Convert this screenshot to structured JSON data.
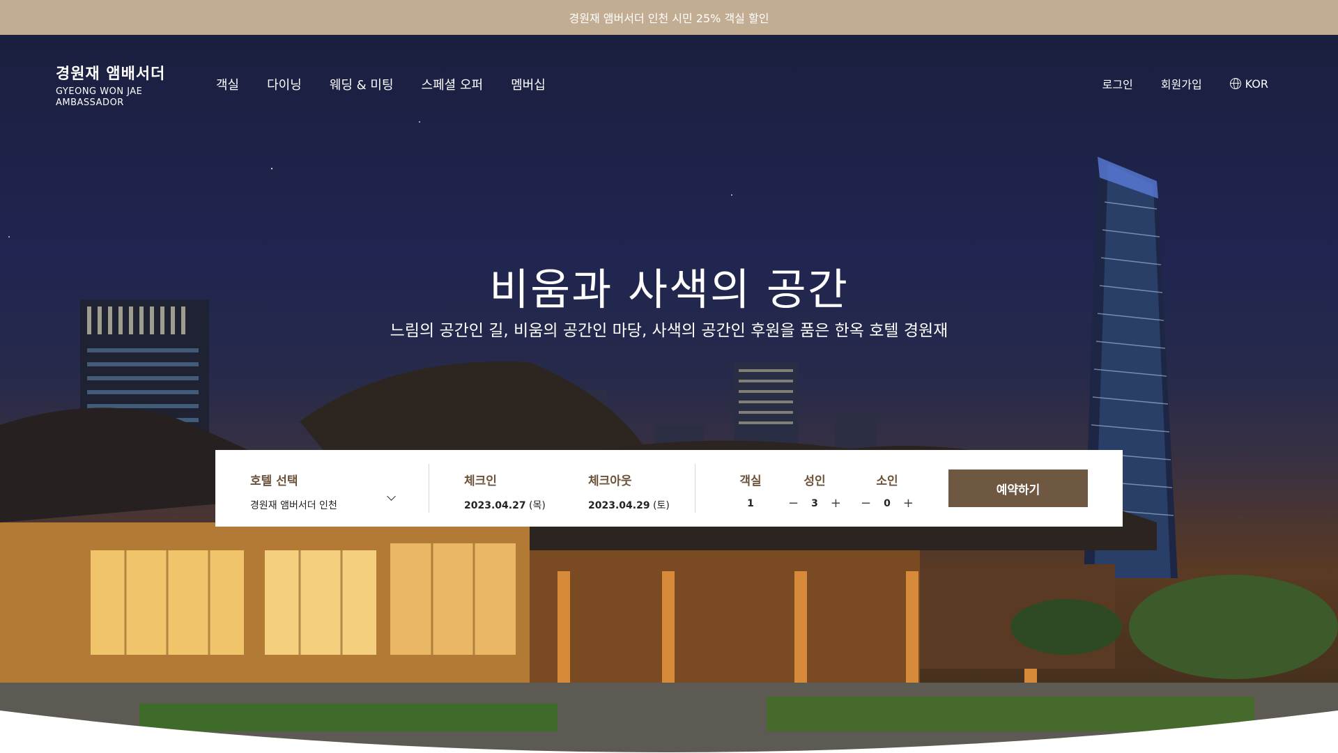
{
  "promo": {
    "text": "경원재 앰버서더 인천 시민 25% 객실 할인"
  },
  "header": {
    "logo_kr": "경원재 앰배서더",
    "logo_en_line1": "GYEONG WON JAE",
    "logo_en_line2": "AMBASSADOR",
    "nav": [
      "객실",
      "다이닝",
      "웨딩 & 미팅",
      "스페셜 오퍼",
      "멤버십"
    ],
    "login": "로그인",
    "signup": "회원가입",
    "lang": "KOR"
  },
  "hero": {
    "title": "비움과 사색의 공간",
    "subtitle": "느림의 공간인 길, 비움의 공간인 마당, 사색의 공간인 후원을 품은 한옥 호텔 경원재"
  },
  "booking": {
    "hotel_label": "호텔 선택",
    "hotel_value": "경원재 앰버서더 인천",
    "checkin_label": "체크인",
    "checkin_date": "2023.04.27",
    "checkin_day": "(목)",
    "checkout_label": "체크아웃",
    "checkout_date": "2023.04.29",
    "checkout_day": "(토)",
    "rooms_label": "객실",
    "rooms_value": "1",
    "adults_label": "성인",
    "adults_value": "3",
    "kids_label": "소인",
    "kids_value": "0",
    "minus": "−",
    "plus": "+",
    "reserve_label": "예약하기"
  },
  "colors": {
    "promo_bg": "#c2ad92",
    "accent_brown": "#6e5842",
    "label_brown": "#6b5238"
  }
}
